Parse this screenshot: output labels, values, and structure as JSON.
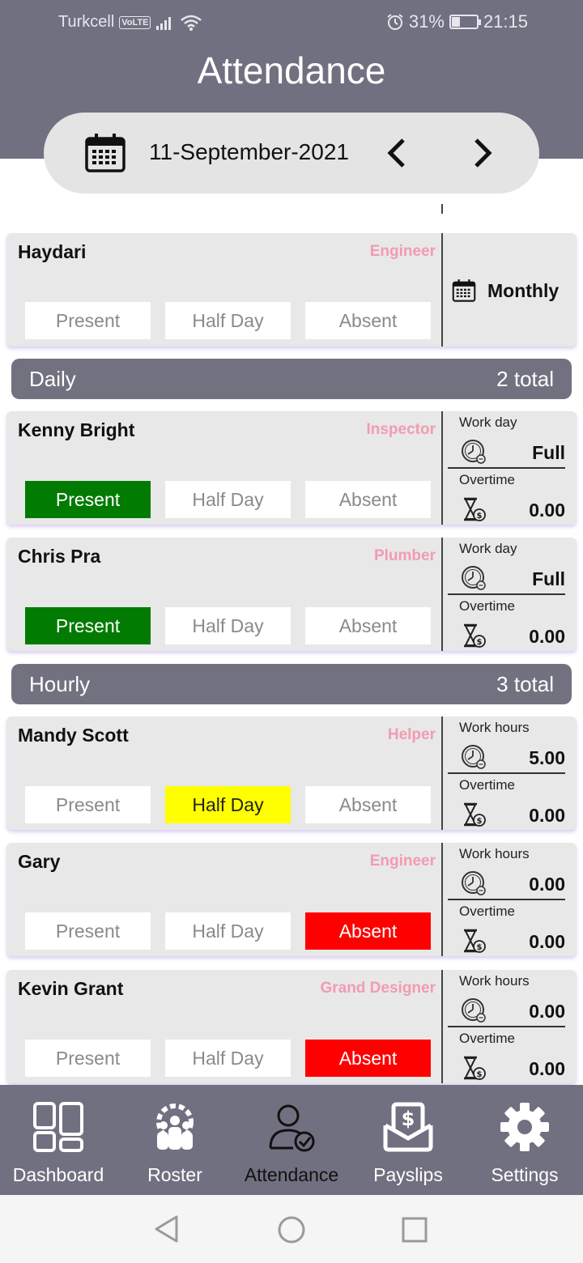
{
  "status_bar": {
    "carrier": "Turkcell",
    "volte": "VoLTE",
    "battery": "31%",
    "time": "21:15",
    "battery_level": 0.31
  },
  "header": {
    "title": "Attendance",
    "date": "11-September-2021"
  },
  "options": {
    "present": "Present",
    "half_day": "Half Day",
    "absent": "Absent"
  },
  "stat_labels": {
    "work_day": "Work day",
    "work_hours": "Work hours",
    "overtime": "Overtime"
  },
  "monthly_employee": {
    "name": "Haydari",
    "role": "Engineer",
    "type_label": "Monthly",
    "selected": "none"
  },
  "sections": {
    "daily": {
      "title": "Daily",
      "count": "2 total"
    },
    "hourly": {
      "title": "Hourly",
      "count": "3 total"
    }
  },
  "daily_employees": [
    {
      "name": "Kenny Bright",
      "role": "Inspector",
      "selected": "present",
      "work": "Full",
      "overtime": "0.00"
    },
    {
      "name": "Chris Pra",
      "role": "Plumber",
      "selected": "present",
      "work": "Full",
      "overtime": "0.00"
    }
  ],
  "hourly_employees": [
    {
      "name": "Mandy Scott",
      "role": "Helper",
      "selected": "half_day",
      "work": "5.00",
      "overtime": "0.00"
    },
    {
      "name": "Gary",
      "role": "Engineer",
      "selected": "absent",
      "work": "0.00",
      "overtime": "0.00"
    },
    {
      "name": "Kevin Grant",
      "role": "Grand Designer",
      "selected": "absent",
      "work": "0.00",
      "overtime": "0.00"
    }
  ],
  "bottom_nav": [
    {
      "label": "Dashboard",
      "icon": "dashboard-icon"
    },
    {
      "label": "Roster",
      "icon": "roster-icon"
    },
    {
      "label": "Attendance",
      "icon": "attendance-icon",
      "active": true
    },
    {
      "label": "Payslips",
      "icon": "payslips-icon"
    },
    {
      "label": "Settings",
      "icon": "settings-icon"
    }
  ],
  "colors": {
    "header": "#717080",
    "present": "#017b01",
    "half_day": "#ffff00",
    "absent": "#ff0000",
    "role": "#f29bb2"
  }
}
